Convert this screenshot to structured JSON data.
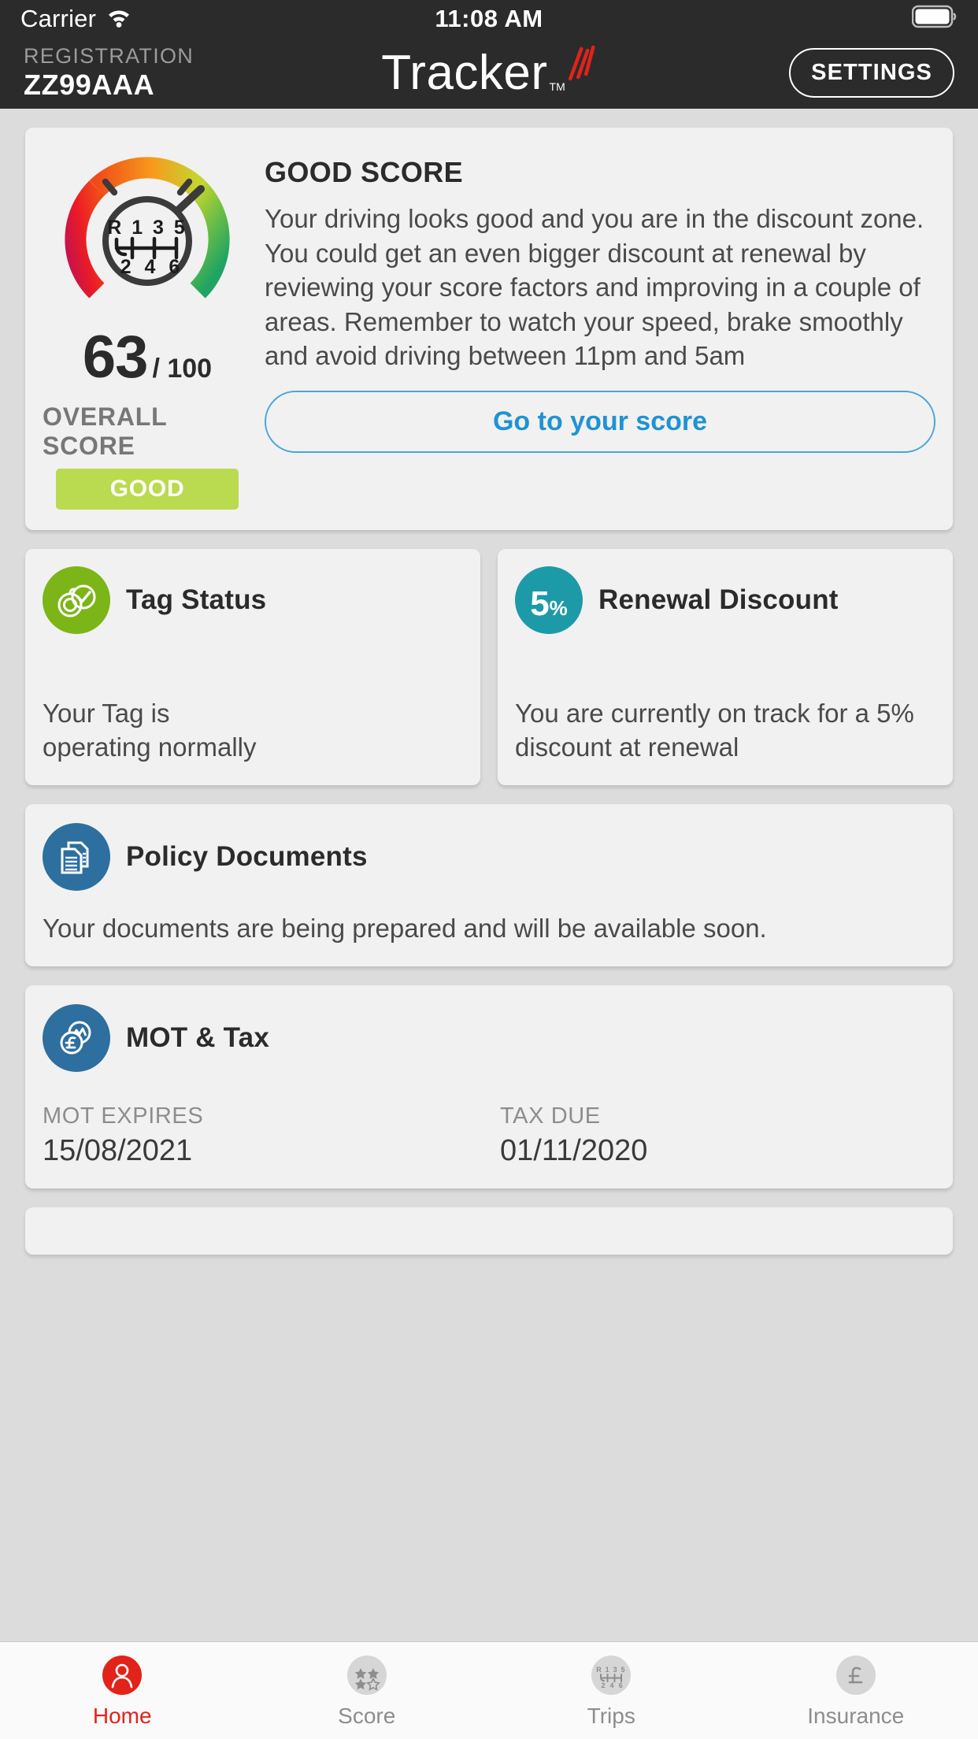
{
  "status_bar": {
    "carrier": "Carrier",
    "wifi_icon": "wifi-icon",
    "time": "11:08 AM",
    "battery_icon": "battery-full-icon"
  },
  "header": {
    "registration_label": "REGISTRATION",
    "registration_value": "ZZ99AAA",
    "brand_name": "Tracker",
    "brand_tm": "TM",
    "settings_label": "SETTINGS"
  },
  "score_card": {
    "gauge": {
      "value": 63,
      "max": 100,
      "needle_icon": "gauge-needle-icon",
      "center_icon": "gear-shift-icon",
      "gear_top": "R 1 3 5",
      "gear_bottom": "2 4 6"
    },
    "score_value": "63",
    "score_max": "/ 100",
    "caption": "OVERALL SCORE",
    "badge": "GOOD",
    "badge_color": "#bada4f",
    "title": "GOOD SCORE",
    "description": "Your driving looks good and you are in the discount zone. You could get an even bigger discount at renewal by reviewing your score factors and improving in a couple of areas. Remember to watch your speed, brake smoothly and avoid driving between 11pm and 5am",
    "cta_label": "Go to your score",
    "cta_color": "#1f92d4"
  },
  "tag_status": {
    "icon": "tag-check-icon",
    "icon_color": "#7cb518",
    "title": "Tag Status",
    "body": "Your Tag is\noperating normally"
  },
  "renewal_discount": {
    "icon": "percent-badge-icon",
    "icon_color": "#1d9aa8",
    "percent": "5",
    "percent_symbol": "%",
    "title": "Renewal Discount",
    "body": "You are currently on track for a 5%\ndiscount at renewal"
  },
  "policy_documents": {
    "icon": "documents-icon",
    "icon_color": "#2d6f9e",
    "title": "Policy Documents",
    "body": "Your documents are being prepared and will be available soon."
  },
  "mot_tax": {
    "icon": "mot-tax-icon",
    "icon_color": "#2d6f9e",
    "title": "MOT & Tax",
    "mot_label": "MOT EXPIRES",
    "mot_value": "15/08/2021",
    "tax_label": "TAX DUE",
    "tax_value": "01/11/2020"
  },
  "tabbar": {
    "active_color": "#e2231a",
    "items": [
      {
        "label": "Home",
        "icon": "home-person-icon",
        "active": true
      },
      {
        "label": "Score",
        "icon": "stars-icon",
        "active": false
      },
      {
        "label": "Trips",
        "icon": "gear-shift-icon",
        "active": false
      },
      {
        "label": "Insurance",
        "icon": "pound-icon",
        "active": false
      }
    ]
  }
}
